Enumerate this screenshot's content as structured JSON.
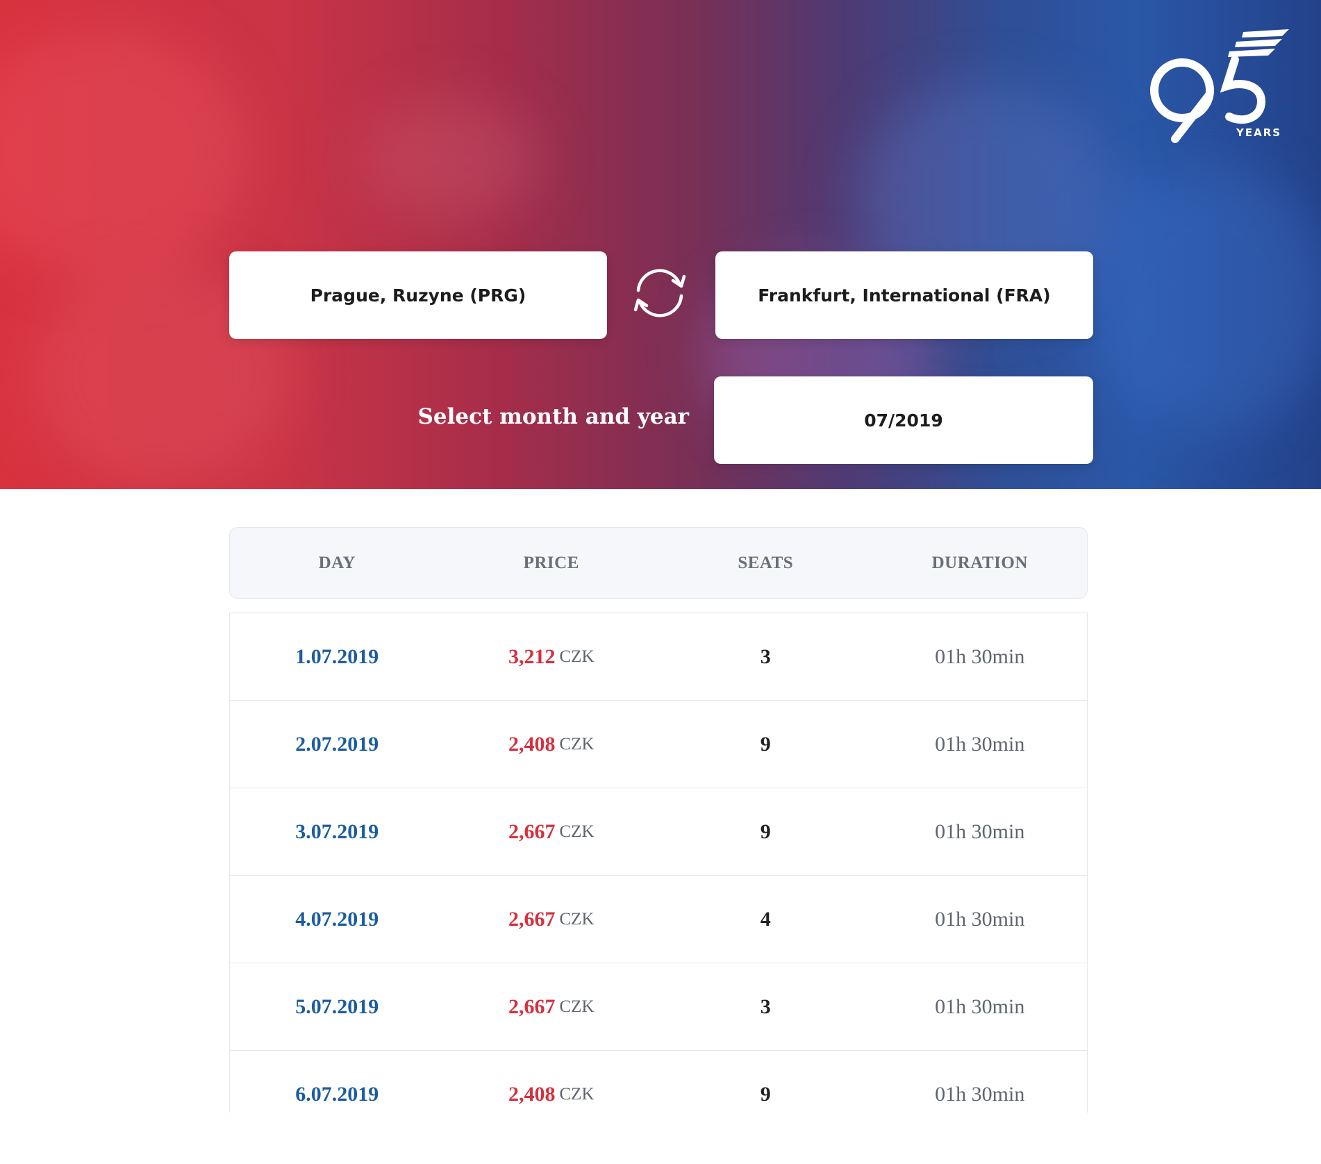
{
  "header": {
    "logo_number": "95",
    "logo_years": "YEARS"
  },
  "search": {
    "origin": "Prague, Ruzyne (PRG)",
    "destination": "Frankfurt, International (FRA)",
    "swap_icon": "swap-arrows-icon",
    "month_label": "Select month and year",
    "month_value": "07/2019"
  },
  "table": {
    "columns": [
      "DAY",
      "PRICE",
      "SEATS",
      "DURATION"
    ],
    "rows": [
      {
        "day": "1.07.2019",
        "price": "3,212",
        "currency": "CZK",
        "seats": "3",
        "duration": "01h 30min"
      },
      {
        "day": "2.07.2019",
        "price": "2,408",
        "currency": "CZK",
        "seats": "9",
        "duration": "01h 30min"
      },
      {
        "day": "3.07.2019",
        "price": "2,667",
        "currency": "CZK",
        "seats": "9",
        "duration": "01h 30min"
      },
      {
        "day": "4.07.2019",
        "price": "2,667",
        "currency": "CZK",
        "seats": "4",
        "duration": "01h 30min"
      },
      {
        "day": "5.07.2019",
        "price": "2,667",
        "currency": "CZK",
        "seats": "3",
        "duration": "01h 30min"
      },
      {
        "day": "6.07.2019",
        "price": "2,408",
        "currency": "CZK",
        "seats": "9",
        "duration": "01h 30min"
      }
    ]
  },
  "colors": {
    "day": "#1b5ca0",
    "price": "#d6303d",
    "hero_left": "#d8323f",
    "hero_right": "#23428a"
  }
}
